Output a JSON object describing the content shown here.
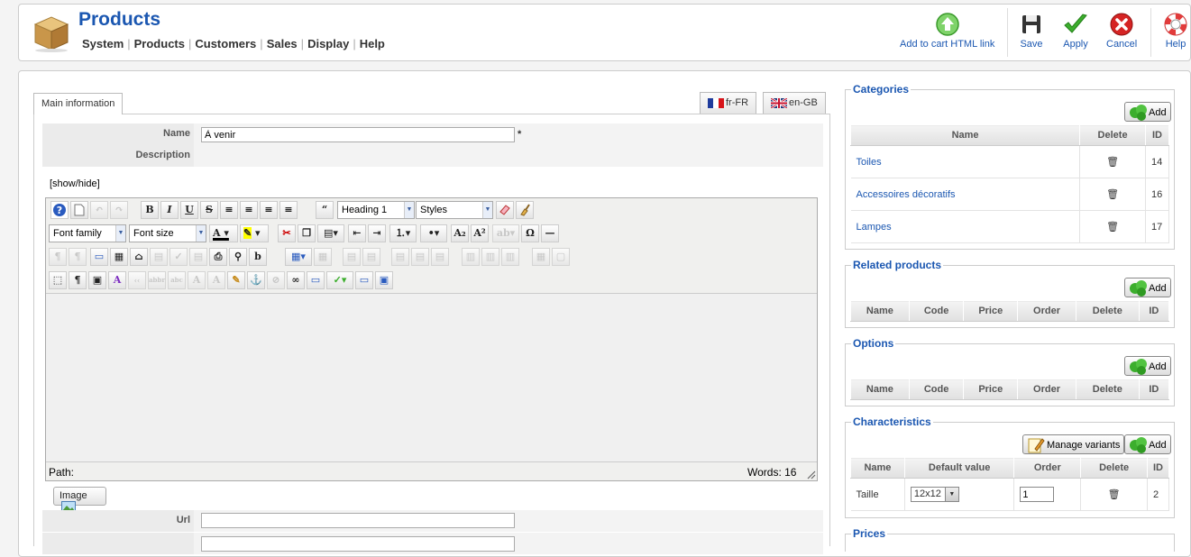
{
  "header": {
    "title": "Products",
    "menu": [
      "System",
      "Products",
      "Customers",
      "Sales",
      "Display",
      "Help"
    ],
    "toolbar": {
      "add_to_cart": "Add to cart HTML link",
      "save": "Save",
      "apply": "Apply",
      "cancel": "Cancel",
      "help": "Help"
    }
  },
  "tabs": {
    "main": "Main information",
    "fr": "fr-FR",
    "en": "en-GB"
  },
  "form": {
    "name_label": "Name",
    "name_value": "À venir",
    "required_mark": "*",
    "description_label": "Description",
    "show_hide": "[show/hide]",
    "url_label": "Url"
  },
  "editor": {
    "format_select": "Heading 1",
    "styles_select": "Styles",
    "font_family": "Font family",
    "font_size": "Font size",
    "path_label": "Path:",
    "words": "Words: 16",
    "image_button": "Image"
  },
  "categories": {
    "legend": "Categories",
    "add": "Add",
    "headers": [
      "Name",
      "Delete",
      "ID"
    ],
    "rows": [
      {
        "name": "Toiles",
        "id": "14"
      },
      {
        "name": "Accessoires décoratifs",
        "id": "16"
      },
      {
        "name": "Lampes",
        "id": "17"
      }
    ]
  },
  "related": {
    "legend": "Related products",
    "add": "Add",
    "headers": [
      "Name",
      "Code",
      "Price",
      "Order",
      "Delete",
      "ID"
    ]
  },
  "options": {
    "legend": "Options",
    "add": "Add",
    "headers": [
      "Name",
      "Code",
      "Price",
      "Order",
      "Delete",
      "ID"
    ]
  },
  "characteristics": {
    "legend": "Characteristics",
    "manage": "Manage variants",
    "add": "Add",
    "headers": [
      "Name",
      "Default value",
      "Order",
      "Delete",
      "ID"
    ],
    "row": {
      "name": "Taille",
      "default": "12x12",
      "order": "1",
      "id": "2"
    }
  },
  "prices": {
    "legend": "Prices"
  },
  "colors": {
    "brand_blue": "#1b57b1",
    "add_green": "#3cae2d",
    "cancel_red": "#d52424"
  }
}
